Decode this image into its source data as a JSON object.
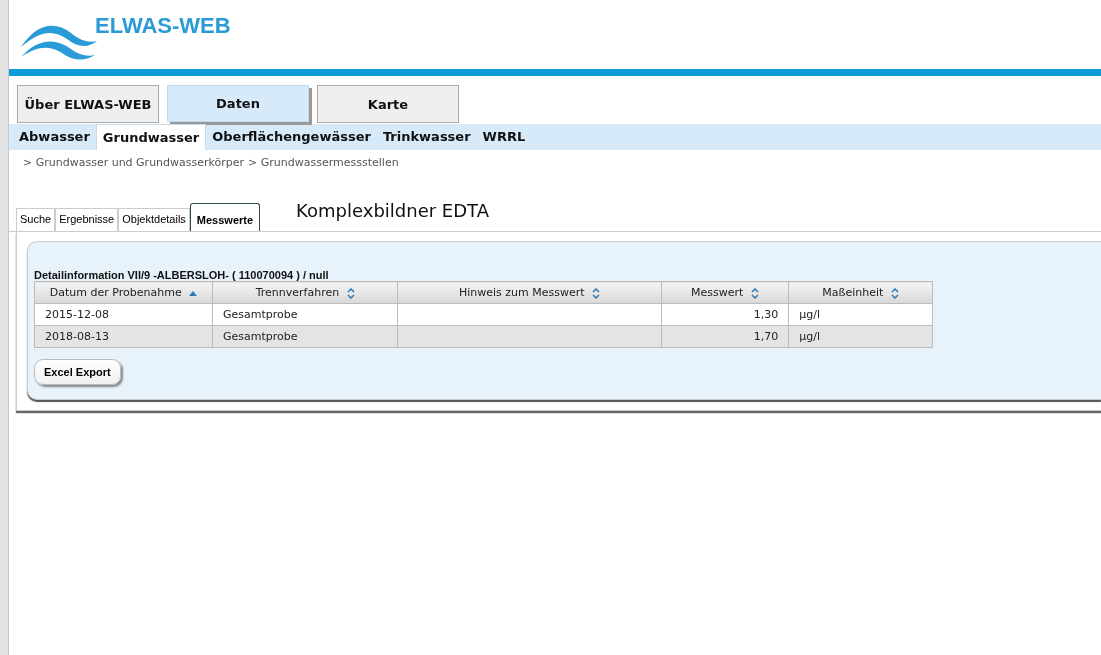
{
  "logo": {
    "text": "ELWAS-WEB"
  },
  "main_nav": [
    {
      "label": "Über ELWAS-WEB",
      "selected": false
    },
    {
      "label": "Daten",
      "selected": true
    },
    {
      "label": "Karte",
      "selected": false
    }
  ],
  "sub_nav": [
    {
      "label": "Abwasser",
      "selected": false
    },
    {
      "label": "Grundwasser",
      "selected": true
    },
    {
      "label": "Oberflächengewässer",
      "selected": false
    },
    {
      "label": "Trinkwasser",
      "selected": false
    },
    {
      "label": "WRRL",
      "selected": false
    }
  ],
  "breadcrumb": [
    "> Grundwasser und Grundwasserkörper",
    "> Grundwassermessstellen"
  ],
  "tabs": [
    {
      "label": "Suche",
      "selected": false
    },
    {
      "label": "Ergebnisse",
      "selected": false
    },
    {
      "label": "Objektdetails",
      "selected": false
    },
    {
      "label": "Messwerte",
      "selected": true
    }
  ],
  "heading": "Komplexbildner EDTA",
  "table": {
    "caption": "Detailinformation VII/9 -ALBERSLOH- ( 110070094 ) / null",
    "columns": [
      {
        "label": "Datum der Probenahme",
        "sorted": true
      },
      {
        "label": "Trennverfahren",
        "sorted": false
      },
      {
        "label": "Hinweis zum Messwert",
        "sorted": false
      },
      {
        "label": "Messwert",
        "sorted": false,
        "kind": "number"
      },
      {
        "label": "Maßeinheit",
        "sorted": false
      }
    ],
    "rows": [
      [
        "2015-12-08",
        "Gesamtprobe",
        "",
        "1,30",
        "µg/l"
      ],
      [
        "2018-08-13",
        "Gesamtprobe",
        "",
        "1,70",
        "µg/l"
      ]
    ]
  },
  "export_button": "Excel Export"
}
